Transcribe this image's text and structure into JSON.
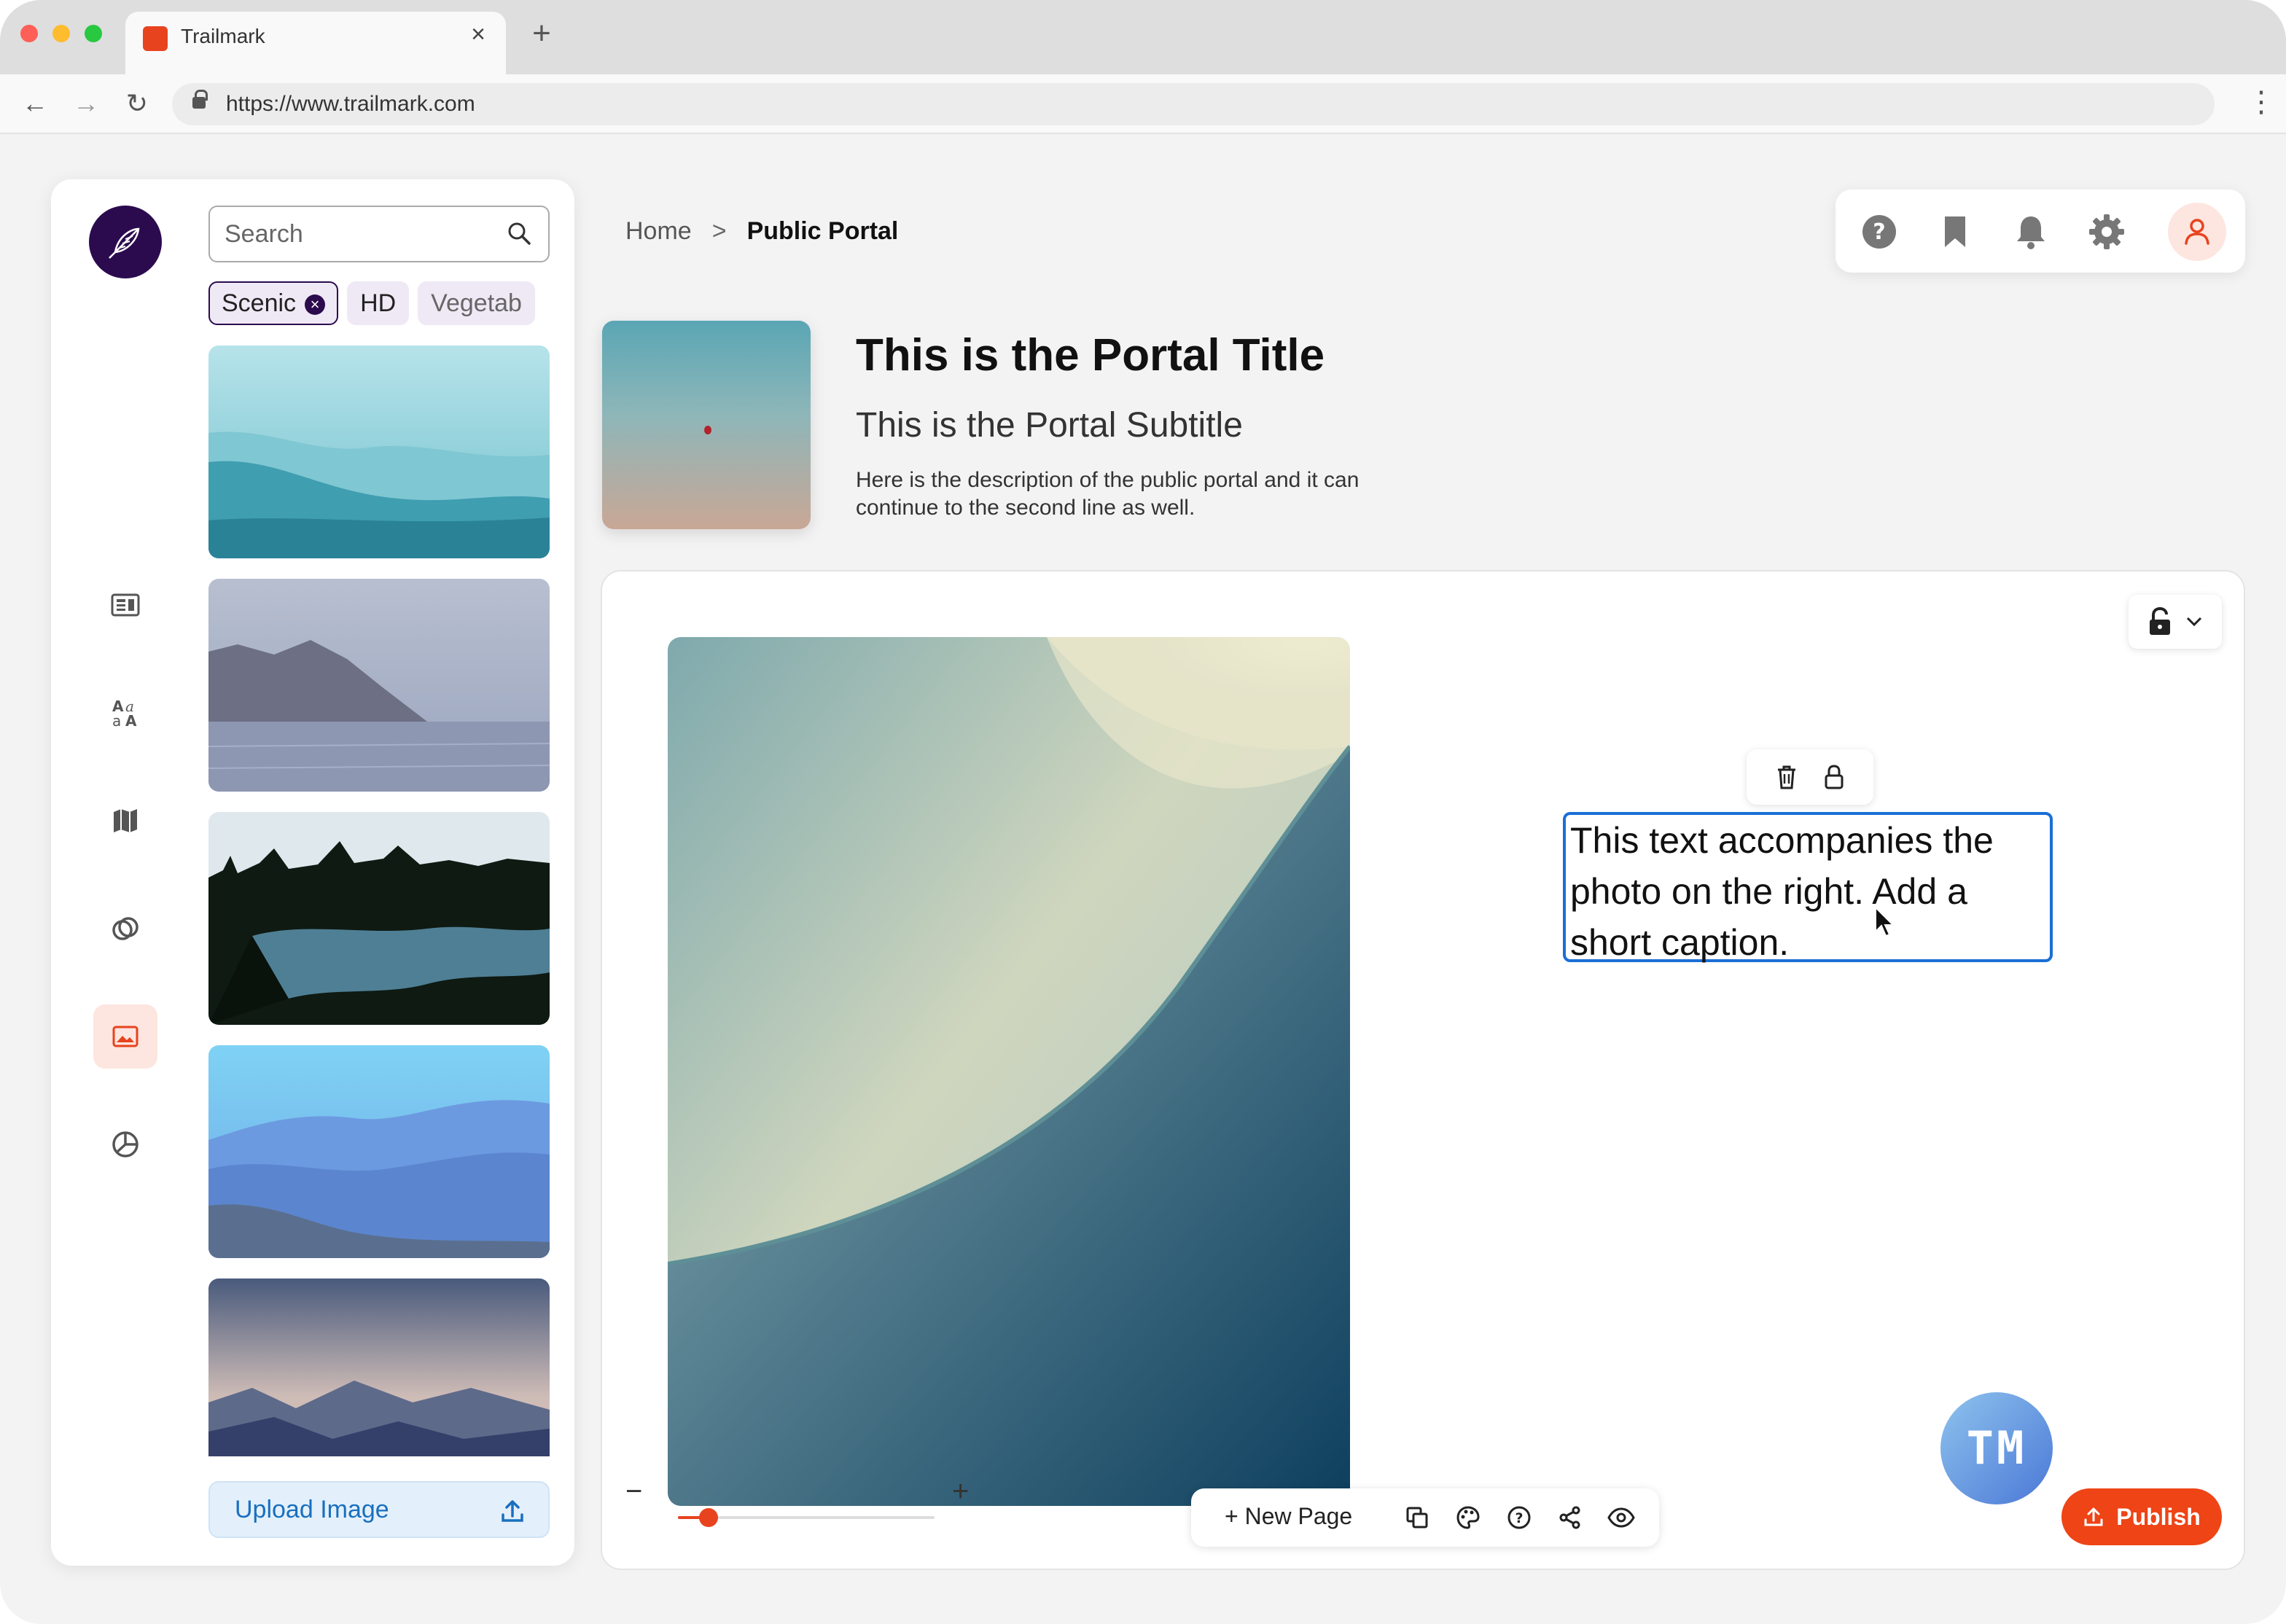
{
  "browser": {
    "tab_title": "Trailmark",
    "tab_close": "×",
    "new_tab": "+",
    "url": "https://www.trailmark.com",
    "back": "←",
    "forward": "→",
    "reload": "↻",
    "menu": "⋮"
  },
  "sidebar": {
    "search_placeholder": "Search",
    "chips": [
      {
        "label": "Scenic",
        "selected": true,
        "remove": "×"
      },
      {
        "label": "HD",
        "selected": false
      },
      {
        "label": "Vegetab",
        "selected": false
      }
    ],
    "rail_icons": [
      "article-icon",
      "typography-icon",
      "map-icon",
      "rings-icon",
      "image-icon",
      "chart-icon"
    ],
    "active_rail_icon": "image-icon",
    "upload_label": "Upload Image"
  },
  "breadcrumb": {
    "home": "Home",
    "separator": ">",
    "current": "Public Portal"
  },
  "header_icons": [
    "help-icon",
    "bookmark-icon",
    "bell-icon",
    "gear-icon",
    "user-icon"
  ],
  "portal": {
    "title": "This is the Portal Title",
    "subtitle": "This is the Portal Subtitle",
    "description": "Here is the description of the public portal and it can continue to the second line as well."
  },
  "editor": {
    "caption": "This text accompanies the photo on the right. Add a short caption.",
    "collaborator_initials": "TM",
    "zoom_minus": "−",
    "zoom_plus": "+",
    "zoom_level": 0.12,
    "new_page_plus": "+",
    "new_page_label": "New Page",
    "publish_label": "Publish"
  },
  "colors": {
    "accent": "#ee4416",
    "brand_dark": "#2b0b4e",
    "selection_blue": "#1a6fd6",
    "upload_blue": "#1a6fbe"
  }
}
